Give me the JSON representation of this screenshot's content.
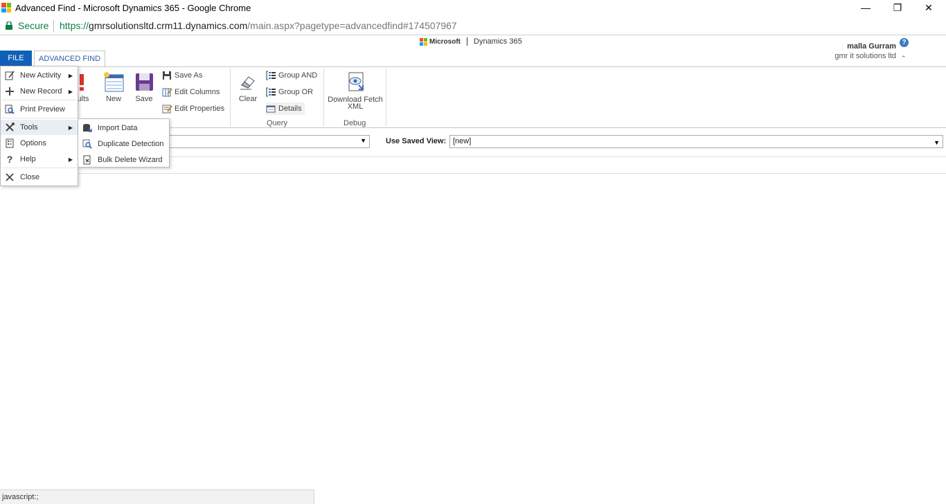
{
  "window": {
    "title": "Advanced Find - Microsoft Dynamics 365 - Google Chrome",
    "controls": {
      "minimize": "—",
      "restore": "❐",
      "close": "✕"
    }
  },
  "address_bar": {
    "secure_label": "Secure",
    "url_scheme": "https://",
    "url_domain": "gmrsolutionsltd.crm11.dynamics.com",
    "url_path": "/main.aspx?pagetype=advancedfind#174507967"
  },
  "header": {
    "brand_microsoft": "Microsoft",
    "brand_product": "Dynamics 365",
    "user_name": "malla Gurram",
    "org_name": "gmr it solutions ltd",
    "help_icon": "?",
    "collapse_icon": "⌃"
  },
  "tabs": {
    "file": "FILE",
    "advanced_find": "ADVANCED FIND"
  },
  "ribbon": {
    "results_partial": "ults",
    "new": "New",
    "save": "Save",
    "save_as": "Save As",
    "edit_columns": "Edit Columns",
    "edit_properties": "Edit Properties",
    "clear": "Clear",
    "group_and": "Group AND",
    "group_or": "Group OR",
    "details": "Details",
    "download_fetch": "Download Fetch",
    "xml": "XML",
    "group_query": "Query",
    "group_debug": "Debug"
  },
  "search": {
    "saved_view_label": "Use Saved View:",
    "saved_view_value": "[new]",
    "dropdown_arrow": "▼"
  },
  "file_menu": {
    "items": [
      {
        "label": "New Activity",
        "icon": "new-activity-icon",
        "has_submenu": true
      },
      {
        "label": "New Record",
        "icon": "plus-icon",
        "has_submenu": true
      },
      {
        "label": "Print Preview",
        "icon": "print-preview-icon",
        "has_submenu": false
      },
      {
        "label": "Tools",
        "icon": "tools-icon",
        "has_submenu": true
      },
      {
        "label": "Options",
        "icon": "options-icon",
        "has_submenu": false
      },
      {
        "label": "Help",
        "icon": "help-question-icon",
        "has_submenu": true
      },
      {
        "label": "Close",
        "icon": "close-icon",
        "has_submenu": false
      }
    ],
    "submenu_arrow": "▶"
  },
  "tools_submenu": {
    "items": [
      {
        "label": "Import Data",
        "icon": "import-data-icon"
      },
      {
        "label": "Duplicate Detection",
        "icon": "duplicate-detection-icon"
      },
      {
        "label": "Bulk Delete Wizard",
        "icon": "bulk-delete-icon"
      }
    ]
  },
  "status_bar": {
    "text": "javascript:;"
  },
  "colors": {
    "file_tab": "#1160b7",
    "accent_blue": "#2a5da6",
    "secure_green": "#0b8043"
  }
}
